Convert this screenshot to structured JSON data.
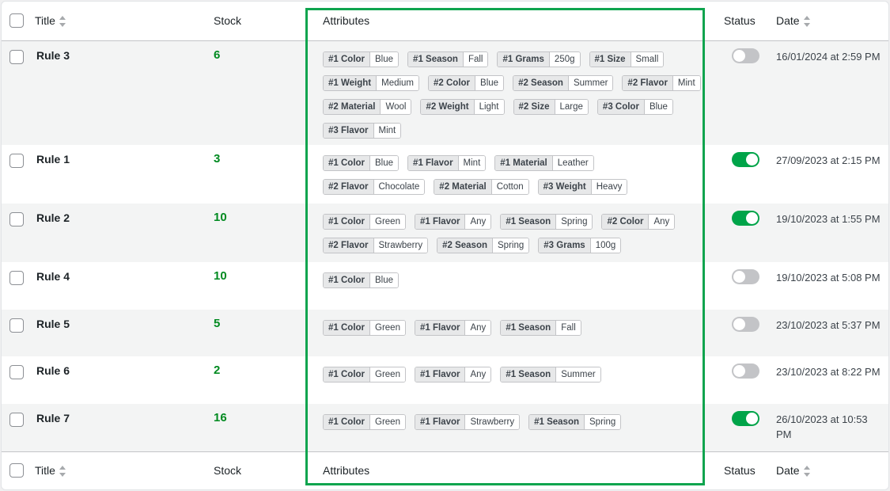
{
  "columns": {
    "title": "Title",
    "stock": "Stock",
    "attributes": "Attributes",
    "status": "Status",
    "date": "Date"
  },
  "colors": {
    "stock": "#008a20",
    "toggle_on": "#00a449",
    "toggle_off": "#c3c4c7",
    "highlight_border": "#0fa44e"
  },
  "rows": [
    {
      "title": "Rule 3",
      "stock": "6",
      "status_on": false,
      "date": "16/01/2024 at 2:59 PM",
      "attributes": [
        {
          "key": "#1 Color",
          "value": "Blue"
        },
        {
          "key": "#1 Season",
          "value": "Fall"
        },
        {
          "key": "#1 Grams",
          "value": "250g"
        },
        {
          "key": "#1 Size",
          "value": "Small"
        },
        {
          "key": "#1 Weight",
          "value": "Medium"
        },
        {
          "key": "#2 Color",
          "value": "Blue"
        },
        {
          "key": "#2 Season",
          "value": "Summer"
        },
        {
          "key": "#2 Flavor",
          "value": "Mint"
        },
        {
          "key": "#2 Material",
          "value": "Wool"
        },
        {
          "key": "#2 Weight",
          "value": "Light"
        },
        {
          "key": "#2 Size",
          "value": "Large"
        },
        {
          "key": "#3 Color",
          "value": "Blue"
        },
        {
          "key": "#3 Flavor",
          "value": "Mint"
        }
      ]
    },
    {
      "title": "Rule 1",
      "stock": "3",
      "status_on": true,
      "date": "27/09/2023 at 2:15 PM",
      "attributes": [
        {
          "key": "#1 Color",
          "value": "Blue"
        },
        {
          "key": "#1 Flavor",
          "value": "Mint"
        },
        {
          "key": "#1 Material",
          "value": "Leather"
        },
        {
          "key": "#2 Flavor",
          "value": "Chocolate"
        },
        {
          "key": "#2 Material",
          "value": "Cotton"
        },
        {
          "key": "#3 Weight",
          "value": "Heavy"
        }
      ]
    },
    {
      "title": "Rule 2",
      "stock": "10",
      "status_on": true,
      "date": "19/10/2023 at 1:55 PM",
      "attributes": [
        {
          "key": "#1 Color",
          "value": "Green"
        },
        {
          "key": "#1 Flavor",
          "value": "Any"
        },
        {
          "key": "#1 Season",
          "value": "Spring"
        },
        {
          "key": "#2 Color",
          "value": "Any"
        },
        {
          "key": "#2 Flavor",
          "value": "Strawberry"
        },
        {
          "key": "#2 Season",
          "value": "Spring"
        },
        {
          "key": "#3 Grams",
          "value": "100g"
        }
      ]
    },
    {
      "title": "Rule 4",
      "stock": "10",
      "status_on": false,
      "date": "19/10/2023 at 5:08 PM",
      "attributes": [
        {
          "key": "#1 Color",
          "value": "Blue"
        }
      ]
    },
    {
      "title": "Rule 5",
      "stock": "5",
      "status_on": false,
      "date": "23/10/2023 at 5:37 PM",
      "attributes": [
        {
          "key": "#1 Color",
          "value": "Green"
        },
        {
          "key": "#1 Flavor",
          "value": "Any"
        },
        {
          "key": "#1 Season",
          "value": "Fall"
        }
      ]
    },
    {
      "title": "Rule 6",
      "stock": "2",
      "status_on": false,
      "date": "23/10/2023 at 8:22 PM",
      "attributes": [
        {
          "key": "#1 Color",
          "value": "Green"
        },
        {
          "key": "#1 Flavor",
          "value": "Any"
        },
        {
          "key": "#1 Season",
          "value": "Summer"
        }
      ]
    },
    {
      "title": "Rule 7",
      "stock": "16",
      "status_on": true,
      "date": "26/10/2023 at 10:53 PM",
      "attributes": [
        {
          "key": "#1 Color",
          "value": "Green"
        },
        {
          "key": "#1 Flavor",
          "value": "Strawberry"
        },
        {
          "key": "#1 Season",
          "value": "Spring"
        }
      ]
    }
  ]
}
